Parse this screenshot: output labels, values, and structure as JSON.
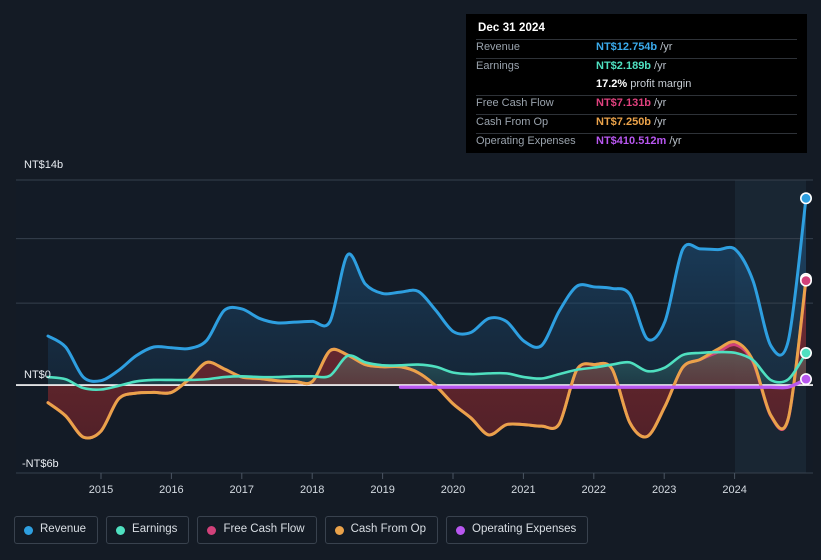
{
  "tooltip": {
    "date": "Dec 31 2024",
    "rows": [
      {
        "label": "Revenue",
        "value": "NT$12.754b",
        "unit": "/yr",
        "color": "#3babec"
      },
      {
        "label": "Earnings",
        "value": "NT$2.189b",
        "unit": "/yr",
        "color": "#4fe0c0"
      },
      {
        "label": "",
        "value": "17.2%",
        "unit": "profit margin",
        "color": "#ffffff"
      },
      {
        "label": "Free Cash Flow",
        "value": "NT$7.131b",
        "unit": "/yr",
        "color": "#e0417e"
      },
      {
        "label": "Cash From Op",
        "value": "NT$7.250b",
        "unit": "/yr",
        "color": "#eaa24a"
      },
      {
        "label": "Operating Expenses",
        "value": "NT$410.512m",
        "unit": "/yr",
        "color": "#b857f0"
      }
    ]
  },
  "axis": {
    "y_top_label": "NT$14b",
    "y_zero_label": "NT$0",
    "y_bottom_label": "-NT$6b"
  },
  "legend": [
    {
      "label": "Revenue",
      "color": "#2e9fe0"
    },
    {
      "label": "Earnings",
      "color": "#4fe0c0"
    },
    {
      "label": "Free Cash Flow",
      "color": "#d1417a"
    },
    {
      "label": "Cash From Op",
      "color": "#eaa24a"
    },
    {
      "label": "Operating Expenses",
      "color": "#b857f0"
    }
  ],
  "chart_data": {
    "type": "area",
    "title": "",
    "xlabel": "",
    "ylabel": "",
    "ylim": [
      -6,
      14
    ],
    "yticks": [
      -6,
      0,
      14
    ],
    "ytick_labels": [
      "-NT$6b",
      "NT$0",
      "NT$14b"
    ],
    "grid": true,
    "legend_position": "bottom",
    "currency": "NT$",
    "units": "billions",
    "categories": [
      "2014.4",
      "2014.65",
      "2014.9",
      "2015.15",
      "2015.4",
      "2015.65",
      "2015.9",
      "2016.15",
      "2016.4",
      "2016.65",
      "2016.9",
      "2017.15",
      "2017.4",
      "2017.65",
      "2017.9",
      "2018.15",
      "2018.4",
      "2018.65",
      "2018.9",
      "2019.15",
      "2019.4",
      "2019.65",
      "2019.9",
      "2020.15",
      "2020.4",
      "2020.65",
      "2020.9",
      "2021.15",
      "2021.4",
      "2021.65",
      "2021.9",
      "2022.15",
      "2022.4",
      "2022.65",
      "2022.9",
      "2023.15",
      "2023.4",
      "2023.65",
      "2023.9",
      "2024.15",
      "2024.4",
      "2024.65",
      "2024.9",
      "2025.0"
    ],
    "x_tick_labels": [
      "2015",
      "2016",
      "2017",
      "2018",
      "2019",
      "2020",
      "2021",
      "2022",
      "2023",
      "2024"
    ],
    "x_tick_values": [
      2015,
      2016,
      2017,
      2018,
      2019,
      2020,
      2021,
      2022,
      2023,
      2024
    ],
    "series": [
      {
        "name": "Revenue",
        "color": "#2e9fe0",
        "fill": "rgba(30,90,140,0.40)",
        "values": [
          3.35,
          2.6,
          0.55,
          0.3,
          1.0,
          2.0,
          2.6,
          2.55,
          2.5,
          3.05,
          5.1,
          5.2,
          4.55,
          4.25,
          4.3,
          4.35,
          4.35,
          8.9,
          6.9,
          6.25,
          6.35,
          6.4,
          5.1,
          3.65,
          3.6,
          4.55,
          4.35,
          3.0,
          2.7,
          5.05,
          6.75,
          6.7,
          6.6,
          6.2,
          3.15,
          4.35,
          9.25,
          9.3,
          9.25,
          9.25,
          7.1,
          2.7,
          3.05,
          12.754
        ]
      },
      {
        "name": "Earnings",
        "color": "#4fe0c0",
        "fill": "rgba(80,190,165,0.22)",
        "values": [
          0.55,
          0.4,
          -0.2,
          -0.3,
          -0.05,
          0.25,
          0.35,
          0.35,
          0.35,
          0.4,
          0.55,
          0.6,
          0.55,
          0.55,
          0.6,
          0.6,
          0.65,
          2.0,
          1.55,
          1.35,
          1.35,
          1.4,
          1.25,
          0.85,
          0.75,
          0.8,
          0.8,
          0.55,
          0.45,
          0.75,
          1.05,
          1.2,
          1.4,
          1.55,
          0.95,
          1.2,
          2.05,
          2.2,
          2.25,
          2.2,
          1.7,
          0.35,
          0.4,
          2.189
        ]
      },
      {
        "name": "Free Cash Flow",
        "color": "#d1417a",
        "fill": "rgba(110,35,45,0.75)",
        "values": [
          -1.2,
          -2.1,
          -3.55,
          -3.15,
          -0.95,
          -0.55,
          -0.5,
          -0.5,
          0.4,
          1.55,
          1.1,
          0.55,
          0.45,
          0.3,
          0.25,
          0.25,
          2.35,
          2.05,
          1.4,
          1.25,
          1.25,
          0.85,
          -0.05,
          -1.3,
          -2.25,
          -3.4,
          -2.7,
          -2.7,
          -2.8,
          -2.65,
          1.05,
          1.4,
          1.1,
          -2.55,
          -3.5,
          -1.45,
          1.2,
          1.75,
          2.25,
          2.75,
          1.55,
          -2.1,
          -2.3,
          7.131
        ]
      },
      {
        "name": "Cash From Op",
        "color": "#eaa24a",
        "fill": "rgba(150,120,60,0.30)",
        "values": [
          -1.2,
          -2.1,
          -3.55,
          -3.15,
          -0.95,
          -0.55,
          -0.5,
          -0.5,
          0.4,
          1.55,
          1.1,
          0.55,
          0.45,
          0.3,
          0.25,
          0.25,
          2.35,
          2.05,
          1.4,
          1.25,
          1.25,
          0.85,
          -0.05,
          -1.3,
          -2.25,
          -3.4,
          -2.7,
          -2.7,
          -2.8,
          -2.65,
          1.05,
          1.4,
          1.1,
          -2.55,
          -3.5,
          -1.45,
          1.2,
          1.75,
          2.45,
          2.95,
          1.65,
          -2.05,
          -2.25,
          7.25
        ]
      },
      {
        "name": "Operating Expenses",
        "color": "#b857f0",
        "start_index": 20,
        "values": [
          null,
          null,
          null,
          null,
          null,
          null,
          null,
          null,
          null,
          null,
          null,
          null,
          null,
          null,
          null,
          null,
          null,
          null,
          null,
          null,
          -0.14,
          -0.14,
          -0.14,
          -0.14,
          -0.14,
          -0.14,
          -0.14,
          -0.14,
          -0.14,
          -0.14,
          -0.14,
          -0.14,
          -0.14,
          -0.14,
          -0.14,
          -0.14,
          -0.14,
          -0.14,
          -0.14,
          -0.14,
          -0.14,
          -0.14,
          -0.14,
          0.411
        ]
      }
    ]
  }
}
